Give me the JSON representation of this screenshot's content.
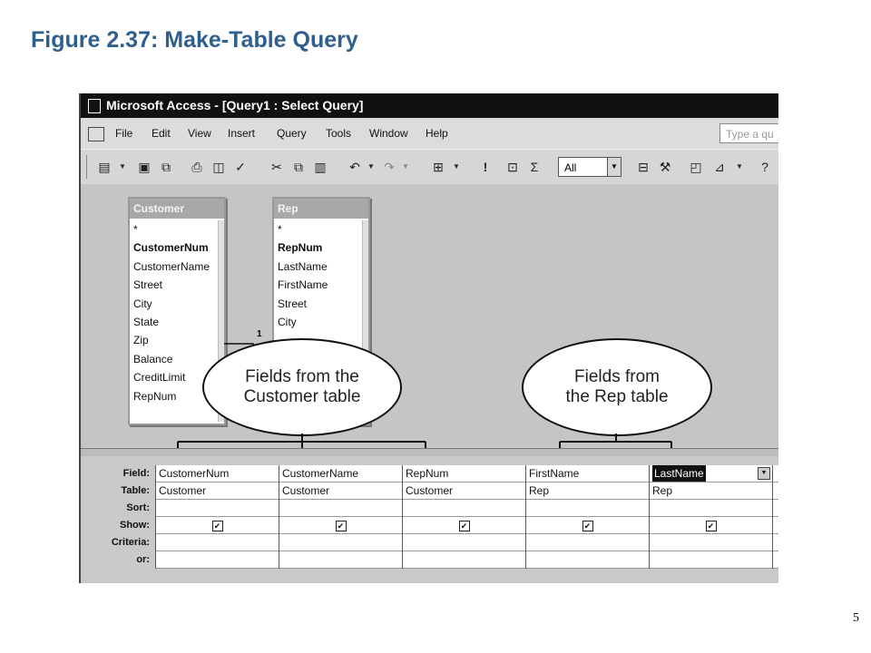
{
  "slide": {
    "title": "Figure 2.37: Make-Table Query",
    "page_number": "5"
  },
  "window": {
    "title": "Microsoft Access - [Query1 : Select Query]"
  },
  "menu": {
    "items": [
      "File",
      "Edit",
      "View",
      "Insert",
      "Query",
      "Tools",
      "Window",
      "Help"
    ],
    "help_placeholder": "Type a qu"
  },
  "toolbar": {
    "top_values": "All"
  },
  "tables": {
    "customer": {
      "title": "Customer",
      "fields": [
        "*",
        "CustomerNum",
        "CustomerName",
        "Street",
        "City",
        "State",
        "Zip",
        "Balance",
        "CreditLimit",
        "RepNum"
      ]
    },
    "rep": {
      "title": "Rep",
      "fields": [
        "*",
        "RepNum",
        "LastName",
        "FirstName",
        "Street",
        "City"
      ]
    }
  },
  "relationship": {
    "one_side": "1"
  },
  "callouts": {
    "customer": [
      "Fields from the",
      "Customer table"
    ],
    "rep": [
      "Fields from",
      "the Rep table"
    ]
  },
  "grid": {
    "row_labels": [
      "Field:",
      "Table:",
      "Sort:",
      "Show:",
      "Criteria:",
      "or:"
    ],
    "columns": [
      {
        "field": "CustomerNum",
        "table": "Customer",
        "show": true
      },
      {
        "field": "CustomerName",
        "table": "Customer",
        "show": true
      },
      {
        "field": "RepNum",
        "table": "Customer",
        "show": true
      },
      {
        "field": "FirstName",
        "table": "Rep",
        "show": true
      },
      {
        "field": "LastName",
        "table": "Rep",
        "show": true,
        "selected": true
      }
    ]
  },
  "icons": {
    "check": "✔",
    "dropdown": "▼"
  }
}
